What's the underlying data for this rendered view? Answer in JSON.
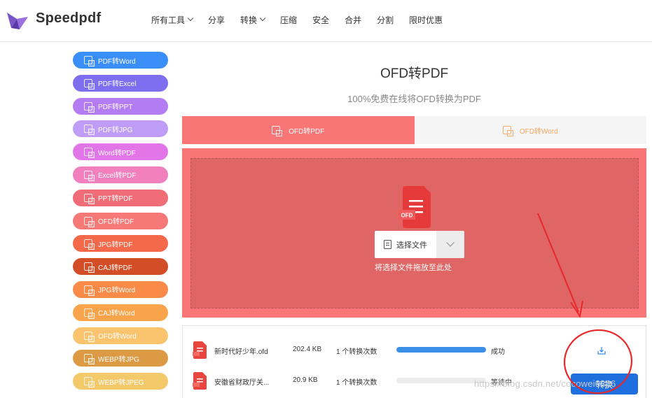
{
  "header": {
    "brand": "Speedpdf",
    "nav": [
      {
        "label": "所有工具",
        "has_dropdown": true
      },
      {
        "label": "分享",
        "has_dropdown": false
      },
      {
        "label": "转换",
        "has_dropdown": true
      },
      {
        "label": "压缩",
        "has_dropdown": false
      },
      {
        "label": "安全",
        "has_dropdown": false
      },
      {
        "label": "合并",
        "has_dropdown": false
      },
      {
        "label": "分割",
        "has_dropdown": false
      },
      {
        "label": "限时优惠",
        "has_dropdown": false
      }
    ]
  },
  "sidebar": {
    "items": [
      {
        "label": "PDF转Word",
        "color": "#3a8ef7"
      },
      {
        "label": "PDF转Excel",
        "color": "#7d6ff0"
      },
      {
        "label": "PDF转PPT",
        "color": "#b37cf2"
      },
      {
        "label": "PDF转JPG",
        "color": "#bf9df7"
      },
      {
        "label": "Word转PDF",
        "color": "#e276e8"
      },
      {
        "label": "Excel转PDF",
        "color": "#f27fbe"
      },
      {
        "label": "PPT转PDF",
        "color": "#f06d78"
      },
      {
        "label": "OFD转PDF",
        "color": "#f67877"
      },
      {
        "label": "JPG转PDF",
        "color": "#f4694a"
      },
      {
        "label": "CAJ转PDF",
        "color": "#d34e26"
      },
      {
        "label": "JPG转Word",
        "color": "#fa8a47"
      },
      {
        "label": "CAJ转Word",
        "color": "#f9a34a"
      },
      {
        "label": "OFD转Word",
        "color": "#fac36d"
      },
      {
        "label": "WEBP转JPG",
        "color": "#dd9a45"
      },
      {
        "label": "WEBP转JPEG",
        "color": "#f4c96a"
      }
    ]
  },
  "main": {
    "title": "OFD转PDF",
    "subtitle": "100%免费在线将OFD转换为PDF",
    "tabs": [
      {
        "label": "OFD转PDF",
        "active": true
      },
      {
        "label": "OFD转Word",
        "active": false
      }
    ],
    "drop": {
      "file_badge": "OFD",
      "select_label": "选择文件",
      "hint": "将选择文件拖放至此处"
    }
  },
  "files": [
    {
      "name": "新时代好少年.ofd",
      "size": "202.4 KB",
      "count": "1 个转换次数",
      "progress": 1.0,
      "status": "成功"
    },
    {
      "name": "安徽省财政厅关...",
      "size": "20.9 KB",
      "count": "1 个转换次数",
      "progress": 0.0,
      "status": "等待中"
    }
  ],
  "actions": {
    "convert_label": "转换"
  },
  "watermark": "https://blog.csdn.net/cocowei0306",
  "colors": {
    "tab_active": "#f87676",
    "drop_zone": "#e06565",
    "progress": "#3b8fe6",
    "convert_button": "#1f6fdf",
    "annotation": "#e8282a"
  }
}
